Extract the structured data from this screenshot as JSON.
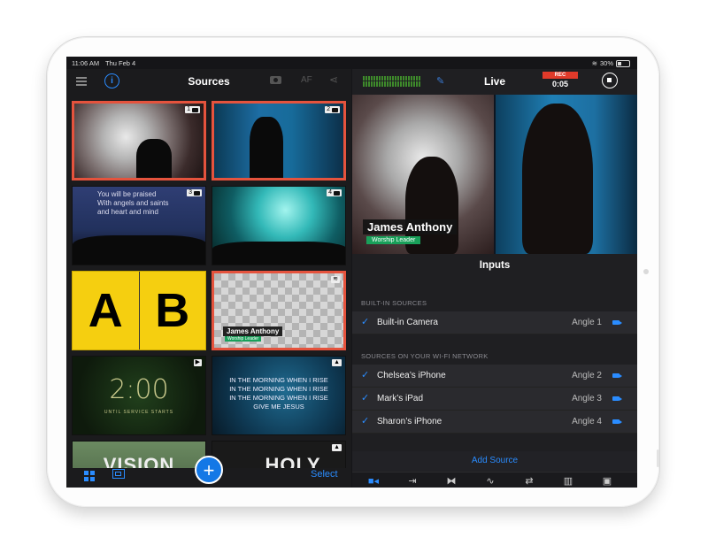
{
  "status_bar": {
    "time": "11:06 AM",
    "date": "Thu Feb 4",
    "battery": "30%"
  },
  "sources_panel": {
    "title": "Sources",
    "af_label": "AF",
    "tiles": [
      {
        "badge": "1"
      },
      {
        "badge": "2"
      },
      {
        "badge": "3",
        "lyric": "You will be praised\nWith angels and saints\nand heart and mind"
      },
      {
        "badge": "4"
      },
      {
        "letters": [
          "A",
          "B"
        ]
      },
      {
        "lower_third_name": "James Anthony",
        "lower_third_subtitle": "Worship Leader"
      },
      {
        "clock": "2:00",
        "clock_caption": "UNTIL SERVICE STARTS"
      },
      {
        "lyrics": "IN THE MORNING WHEN I RISE\nIN THE MORNING WHEN I RISE\nIN THE MORNING WHEN I RISE\nGIVE ME JESUS"
      },
      {
        "big_text": "VISION"
      },
      {
        "big_text": "HOLY"
      }
    ],
    "select_label": "Select",
    "add_label": "+"
  },
  "live_panel": {
    "title": "Live",
    "rec_label": "REC",
    "timer": "0:05",
    "preview": {
      "name": "James Anthony",
      "subtitle": "Worship Leader"
    },
    "inputs_title": "Inputs",
    "built_in_header": "BUILT-IN SOURCES",
    "built_in": [
      {
        "name": "Built-in Camera",
        "angle": "Angle 1"
      }
    ],
    "wifi_header": "SOURCES ON YOUR WI-FI NETWORK",
    "wifi": [
      {
        "name": "Chelsea’s iPhone",
        "angle": "Angle 2"
      },
      {
        "name": "Mark’s iPad",
        "angle": "Angle 3"
      },
      {
        "name": "Sharon’s iPhone",
        "angle": "Angle 4"
      }
    ],
    "add_source_label": "Add Source"
  },
  "colors": {
    "accent": "#2a8cff",
    "record": "#e03a2a",
    "selection": "#e5533d",
    "lower_third": "#19a05a"
  },
  "icons": [
    "menu-icon",
    "info-icon",
    "camera-icon",
    "share-icon",
    "mic-icon",
    "stop-icon",
    "video-icon",
    "output-icon",
    "transition-icon",
    "audio-icon",
    "switch-camera-icon",
    "stats-icon",
    "presenter-icon",
    "grid-view-icon",
    "layout-icon",
    "plus-icon"
  ]
}
